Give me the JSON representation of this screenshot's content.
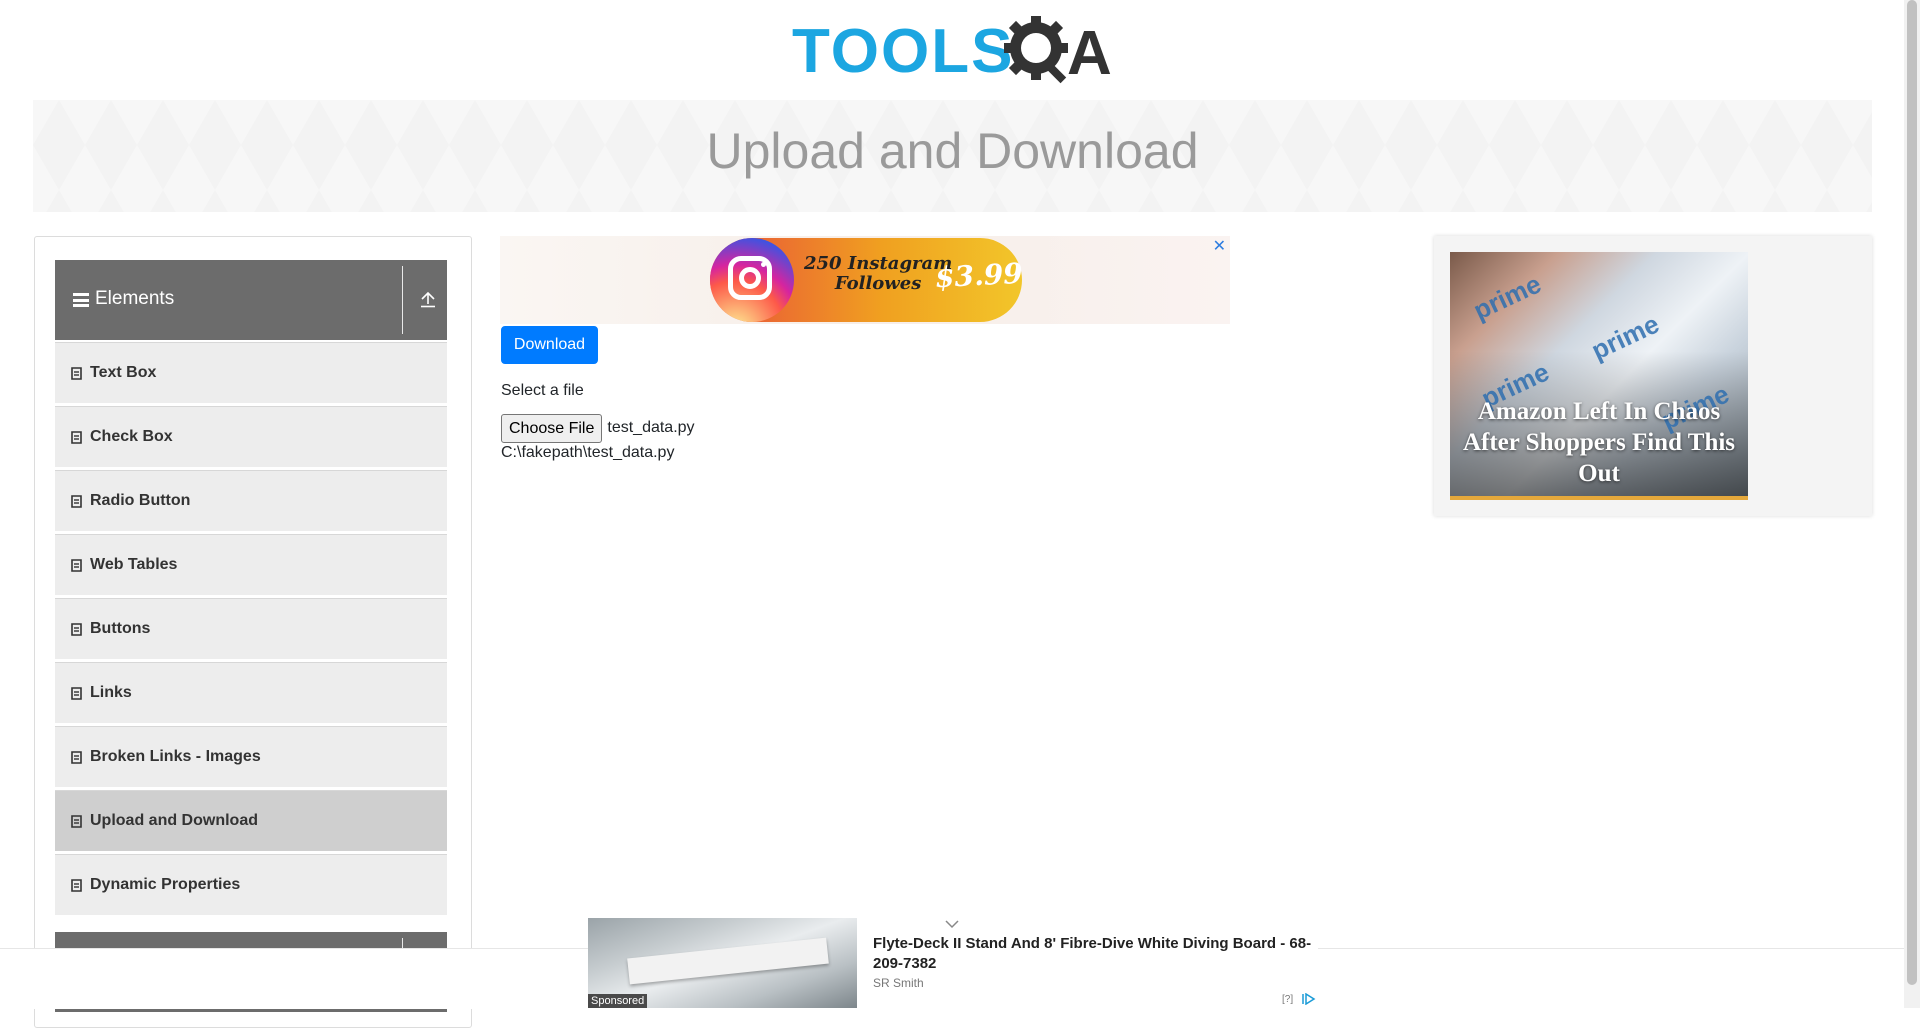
{
  "header": {
    "logo_text": "TOOLS",
    "logo_suffix": "A",
    "logo_brand": "TOOLSQA"
  },
  "banner": {
    "title": "Upload and Download"
  },
  "sidebar": {
    "group_title": "Elements",
    "items": [
      {
        "label": "Text Box"
      },
      {
        "label": "Check Box"
      },
      {
        "label": "Radio Button"
      },
      {
        "label": "Web Tables"
      },
      {
        "label": "Buttons"
      },
      {
        "label": "Links"
      },
      {
        "label": "Broken Links - Images"
      },
      {
        "label": "Upload and Download",
        "active": true
      },
      {
        "label": "Dynamic Properties"
      }
    ]
  },
  "top_ad": {
    "text_line1": "250 Instagram",
    "text_line2": "Followes",
    "price": "$3.99",
    "close": "✕"
  },
  "main": {
    "download_label": "Download",
    "upload_label": "Select a file",
    "choose_file_label": "Choose File",
    "file_name": "test_data.py",
    "uploaded_path": "C:\\fakepath\\test_data.py"
  },
  "right_ad": {
    "headline": "Amazon Left In Chaos After Shoppers Find This Out",
    "photo_text": "prime"
  },
  "bottom_ad": {
    "title": "Flyte-Deck II Stand And 8' Fibre-Dive White Diving Board - 68-209-7382",
    "source": "SR Smith",
    "sponsored": "Sponsored",
    "help": "[?]"
  },
  "colors": {
    "primary": "#007bff",
    "logo_blue": "#1ca6e1",
    "sidebar_header": "#6c6c6c",
    "menu_item_bg": "#ededed",
    "menu_item_active": "#cfcfcf"
  }
}
